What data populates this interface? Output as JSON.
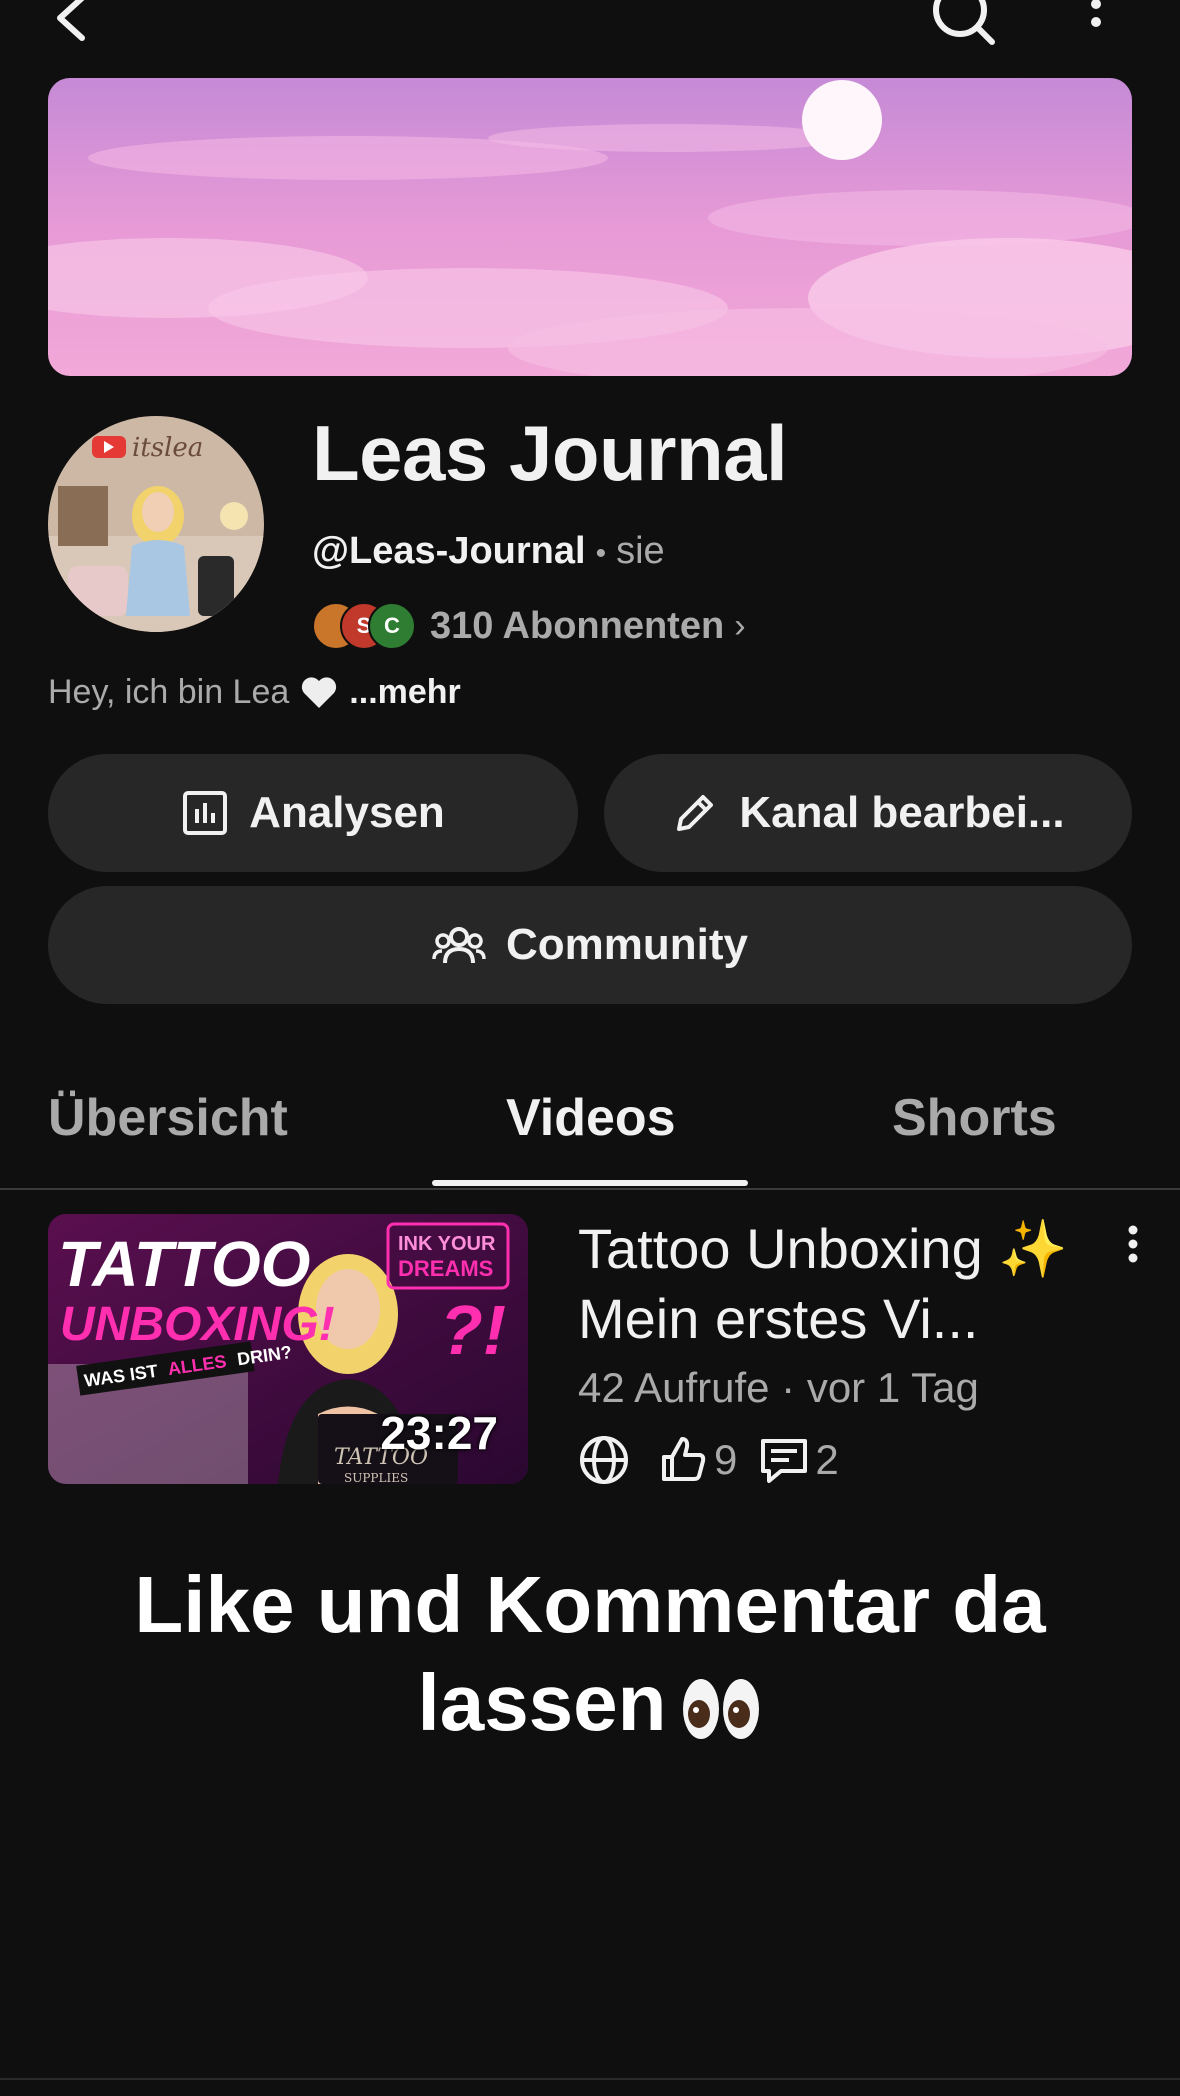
{
  "icons": {
    "back": "chevron-left-icon",
    "search": "search-icon",
    "more": "more-vertical-icon",
    "analytics": "bar-chart-icon",
    "edit": "pencil-icon",
    "community": "people-icon",
    "public": "globe-icon",
    "like": "thumbs-up-icon",
    "comment": "comment-icon"
  },
  "channel": {
    "name": "Leas Journal",
    "handle": "@Leas-Journal",
    "separator": "•",
    "pronouns": "sie",
    "subscribers": "310 Abonnenten",
    "subscribers_chevron": "›",
    "bio": "Hey, ich bin Lea",
    "bio_more": "...mehr",
    "avatar_logo_text": "itslea",
    "sub_avatar_letters": [
      "",
      "S",
      "C"
    ]
  },
  "buttons": {
    "analytics": "Analysen",
    "edit_channel": "Kanal bearbei...",
    "community": "Community"
  },
  "tabs": {
    "overview": "Übersicht",
    "videos": "Videos",
    "shorts": "Shorts",
    "active": "Videos"
  },
  "video": {
    "title": "Tattoo Unboxing ✨ Mein erstes Vi...",
    "duration": "23:27",
    "views": "42 Aufrufe",
    "meta_separator": "·",
    "age": "vor 1 Tag",
    "likes": "9",
    "comments": "2",
    "thumbnail_text": {
      "headline_1": "TATTOO",
      "headline_2": "UNBOXING!",
      "question_prefix": "WAS IST",
      "question_highlight": "ALLES",
      "question_suffix": "DRIN?",
      "badge_1": "INK YOUR",
      "badge_2": "DREAMS",
      "marks": "?!",
      "box_1": "TATTOO",
      "box_2": "SUPPLIES"
    }
  },
  "overlay_caption": {
    "line1": "Like und Kommentar da",
    "line2": "lassen"
  },
  "colors": {
    "background": "#0f0f0f",
    "button_bg": "#272727",
    "text_primary": "#f1f1f1",
    "text_secondary": "#aaaaaa",
    "banner_pink": "#e89ad2",
    "thumb_pink": "#ff2fb0"
  }
}
